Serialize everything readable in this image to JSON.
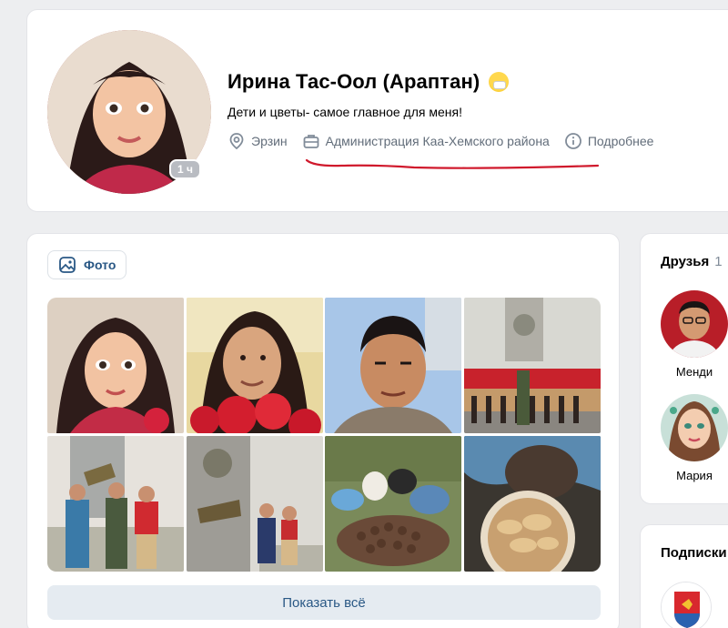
{
  "profile": {
    "name": "Ирина Тас-Оол (Араптан)",
    "status": "Дети и цветы- самое главное для меня!",
    "online": "1 ч",
    "location": "Эрзин",
    "work": "Администрация Каа-Хемского района",
    "more": "Подробнее"
  },
  "photos": {
    "tab_label": "Фото",
    "show_all": "Показать всё",
    "items": [
      {
        "icon": "photo-cartoon-portrait"
      },
      {
        "icon": "photo-woman-with-flowers"
      },
      {
        "icon": "photo-young-man-selfie"
      },
      {
        "icon": "photo-cadets-at-monument"
      },
      {
        "icon": "photo-group-at-memorial"
      },
      {
        "icon": "photo-people-at-memorial"
      },
      {
        "icon": "photo-pine-cones-harvest"
      },
      {
        "icon": "photo-mushrooms-bowl"
      }
    ]
  },
  "friends": {
    "title": "Друзья",
    "count": "1",
    "items": [
      {
        "name": "Менди"
      },
      {
        "name": "Мария"
      }
    ]
  },
  "subscriptions": {
    "title": "Подписки"
  },
  "colors": {
    "background": "#edeef0",
    "link": "#2a5885",
    "muted": "#626d7a",
    "underline": "#d0192c"
  }
}
